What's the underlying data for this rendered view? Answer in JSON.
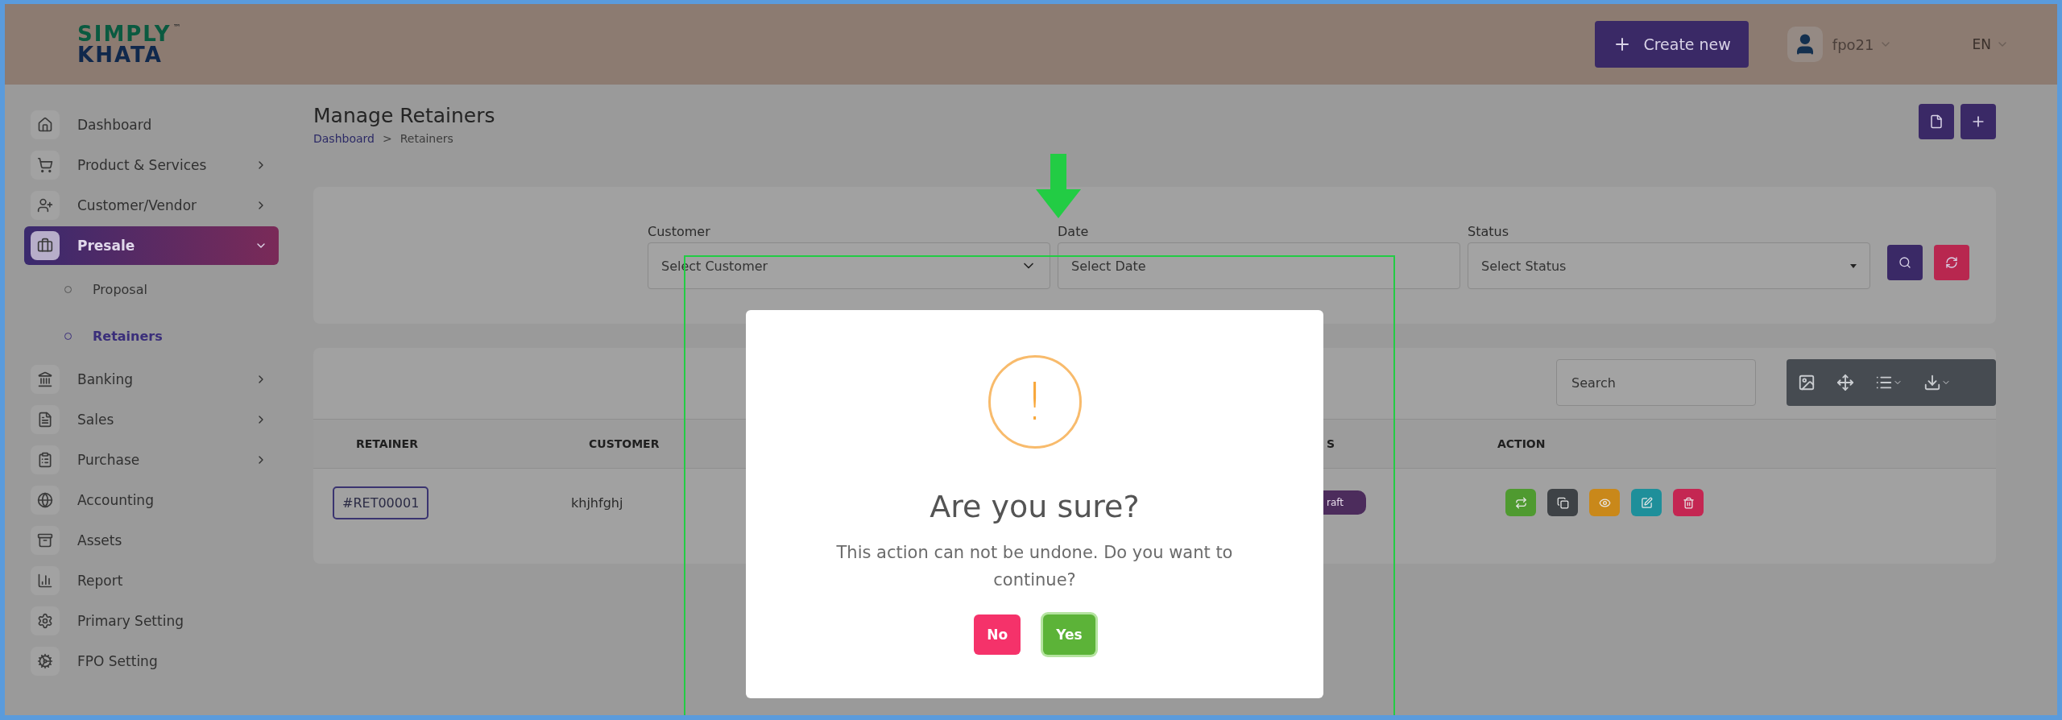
{
  "header": {
    "logo_top": "SIMPLY",
    "logo_bottom": "KHATA",
    "logo_mark": "™",
    "create_button": "Create new",
    "user": "fpo21",
    "language": "EN"
  },
  "sidebar": {
    "items": [
      {
        "label": "Dashboard",
        "selected": false
      },
      {
        "label": "Product & Services",
        "expanded": false,
        "selected": false
      },
      {
        "label": "Customer/Vendor",
        "expanded": false,
        "selected": false
      },
      {
        "label": "Presale",
        "expanded": true,
        "selected": true,
        "children": [
          {
            "label": "Proposal",
            "selected": false
          },
          {
            "label": "Retainers",
            "selected": true
          }
        ]
      },
      {
        "label": "Banking",
        "expanded": false,
        "selected": false
      },
      {
        "label": "Sales",
        "expanded": false,
        "selected": false
      },
      {
        "label": "Purchase",
        "expanded": false,
        "selected": false
      },
      {
        "label": "Accounting",
        "selected": false
      },
      {
        "label": "Assets",
        "selected": false
      },
      {
        "label": "Report",
        "selected": false
      },
      {
        "label": "Primary Setting",
        "selected": false
      },
      {
        "label": "FPO Setting",
        "selected": false
      }
    ]
  },
  "page": {
    "title": "Manage Retainers",
    "breadcrumb": [
      "Dashboard",
      "Retainers"
    ],
    "breadcrumb_separator": ">"
  },
  "filters": [
    {
      "label": "Customer",
      "placeholder": "Select Customer",
      "kind": "select"
    },
    {
      "label": "Date",
      "placeholder": "Select Date",
      "kind": "input"
    },
    {
      "label": "Status",
      "placeholder": "Select Status",
      "kind": "select-small"
    }
  ],
  "table": {
    "search": {
      "placeholder": "Search"
    },
    "columns": [
      "RETAINER",
      "CUSTOMER",
      "",
      "S",
      "ACTION"
    ],
    "rows": [
      {
        "retainer": "#RET00001",
        "customer": "khjhfghj",
        "status": "raft"
      }
    ]
  },
  "dialog": {
    "icon": "!",
    "title": "Are you sure?",
    "message": "This action can not be undone. Do you want to continue?",
    "buttons": [
      {
        "label": "No",
        "kind": "cancel"
      },
      {
        "label": "Yes",
        "kind": "confirm"
      }
    ]
  }
}
